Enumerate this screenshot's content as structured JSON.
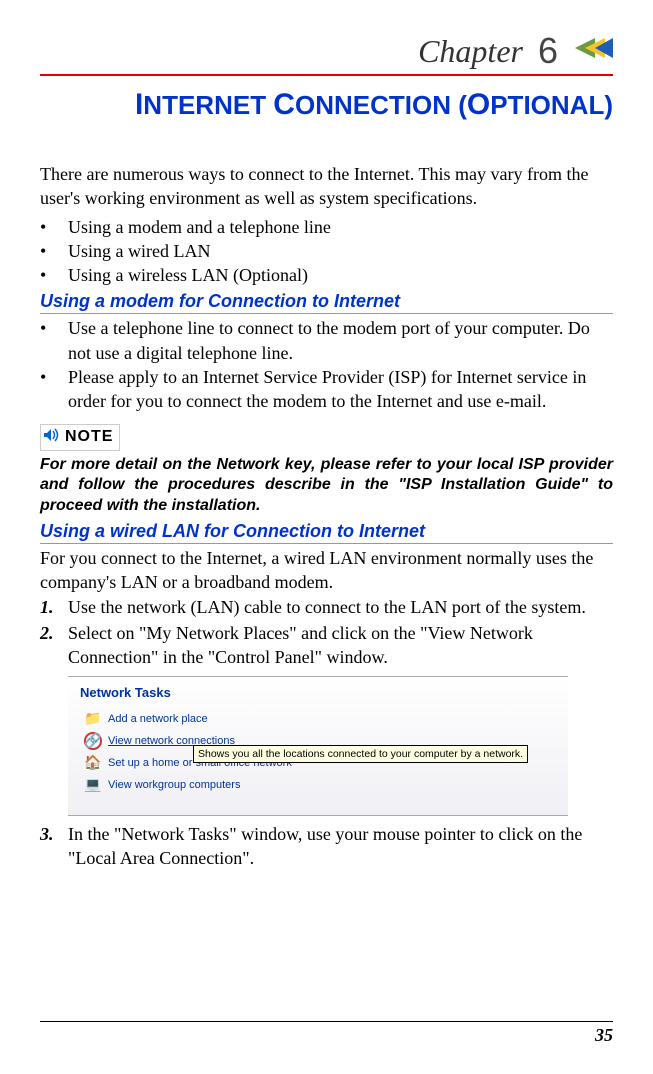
{
  "chapter": {
    "label": "Chapter",
    "number": "6"
  },
  "title_parts": {
    "i": "I",
    "nternet": "NTERNET ",
    "c": "C",
    "onnection": "ONNECTION ",
    "paren_open": "(",
    "o": "O",
    "ptional": "PTIONAL",
    "paren_close": ")"
  },
  "intro": "There are numerous ways to connect to the Internet. This may vary from the user's working environment as well as system specifications.",
  "bullets_main": [
    "Using a modem and a telephone line",
    "Using a wired LAN",
    "Using a wireless LAN (Optional)"
  ],
  "section_modem": {
    "heading": "Using a modem for Connection to Internet",
    "bullets": [
      "Use a telephone line to connect to the modem port of your computer. Do not use a digital telephone line.",
      "Please apply to an Internet Service Provider (ISP) for Internet service in order for you to connect the modem to the Internet and use e-mail."
    ]
  },
  "note": {
    "label": "NOTE",
    "text": "For more detail on the Network key, please refer to your local ISP provider and follow the procedures describe in the \"ISP Installation Guide\" to proceed with the installation."
  },
  "section_lan": {
    "heading": "Using a wired LAN for Connection to Internet",
    "intro": "For you connect to the Internet, a wired LAN environment normally uses the company's LAN or a broadband modem.",
    "steps": [
      "Use the network (LAN) cable to connect to the LAN port of the system.",
      "Select on \"My Network Places\" and click on the \"View Network Connection\" in the \"Control Panel\" window.",
      "In the \"Network Tasks\" window, use your mouse pointer to click on the \"Local Area Connection\"."
    ]
  },
  "screenshot": {
    "panel_title": "Network Tasks",
    "items": [
      "Add a network place",
      "View network connections",
      "Set up a home or small office network",
      "View workgroup computers"
    ],
    "tooltip": "Shows you all the locations connected to your computer by a network."
  },
  "page_number": "35"
}
